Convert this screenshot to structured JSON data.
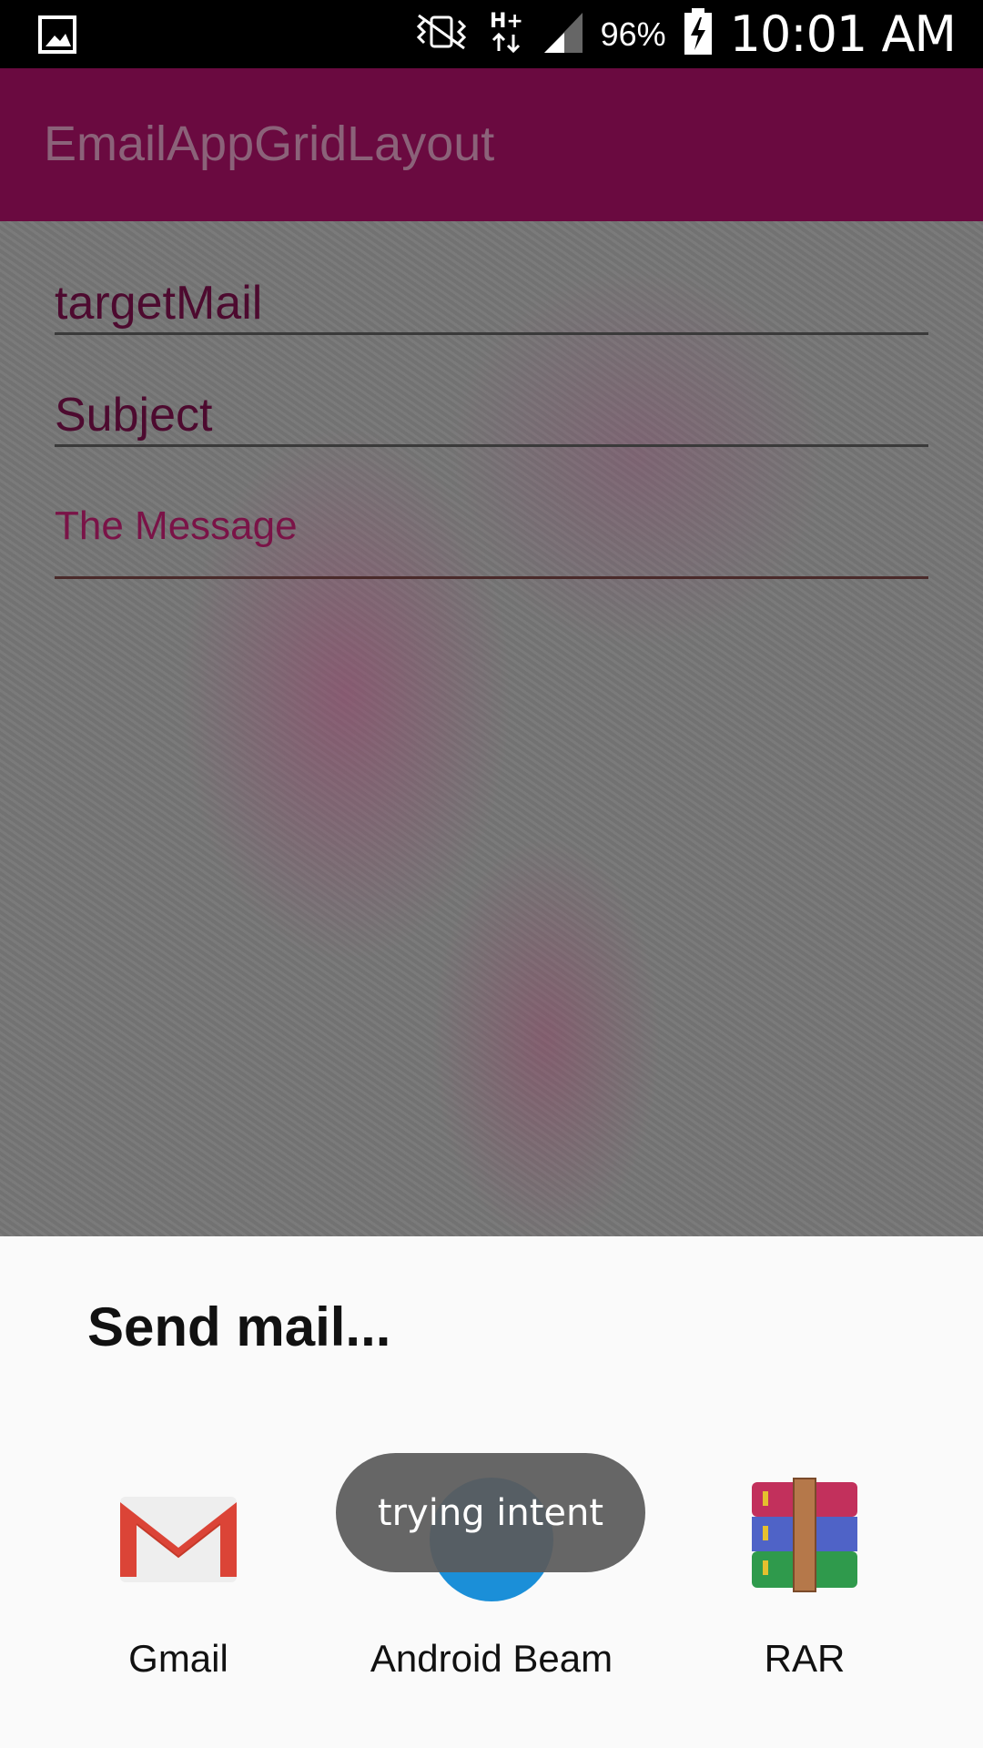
{
  "status_bar": {
    "battery_percent": "96%",
    "time": "10:01 AM",
    "icons": [
      "image-icon",
      "vibrate-icon",
      "hplus-data-icon",
      "signal-icon",
      "battery-charging-icon"
    ]
  },
  "app_bar": {
    "title": "EmailAppGridLayout"
  },
  "form": {
    "target_mail_placeholder": "targetMail",
    "subject_placeholder": "Subject",
    "message_placeholder": "The Message"
  },
  "share_sheet": {
    "title": "Send mail...",
    "apps": [
      {
        "label": "Gmail",
        "icon": "gmail-icon"
      },
      {
        "label": "Android Beam",
        "icon": "android-beam-icon"
      },
      {
        "label": "RAR",
        "icon": "rar-icon"
      }
    ]
  },
  "toast": {
    "text": "trying intent"
  },
  "colors": {
    "app_bar": "#6a0a40",
    "accent": "#7a1347",
    "sheet_bg": "#fafafa",
    "beam_blue": "#1b8fd8"
  }
}
